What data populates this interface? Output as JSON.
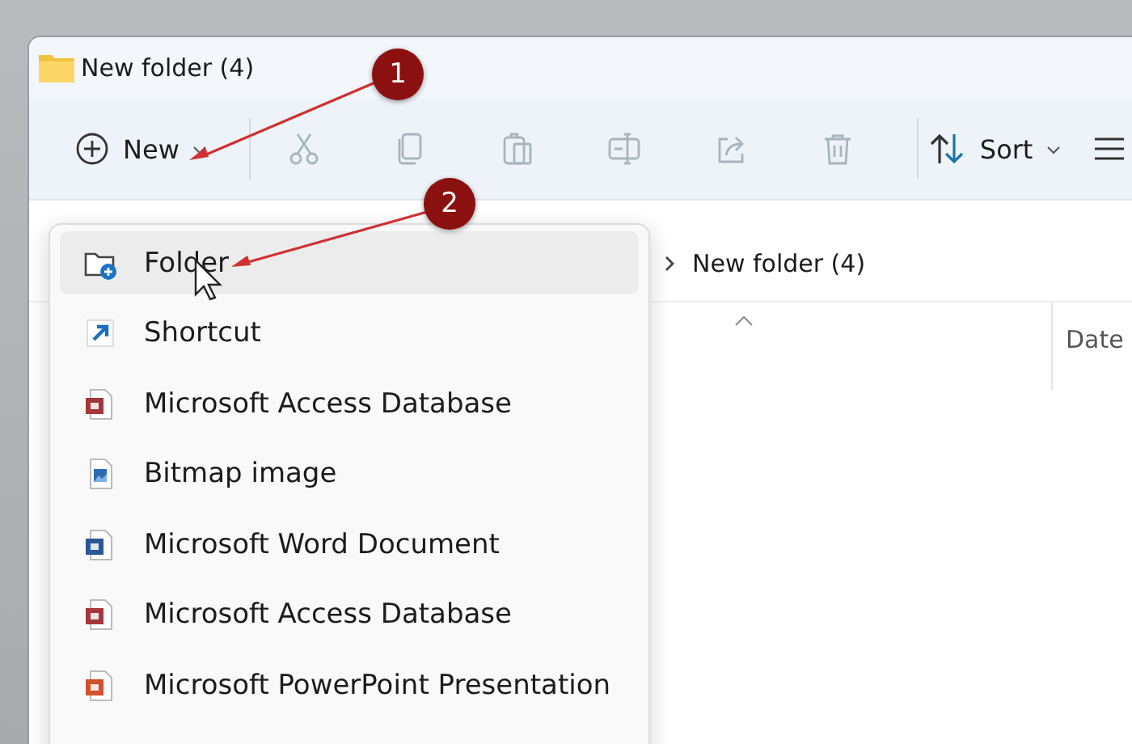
{
  "window": {
    "title": "New folder (4)"
  },
  "toolbar": {
    "items": [
      {
        "kind": "new",
        "label": "New",
        "disabled": false
      },
      {
        "kind": "cut",
        "disabled": true
      },
      {
        "kind": "copy",
        "disabled": true
      },
      {
        "kind": "paste",
        "disabled": true
      },
      {
        "kind": "rename",
        "disabled": true
      },
      {
        "kind": "share",
        "disabled": true
      },
      {
        "kind": "delete",
        "disabled": true
      },
      {
        "kind": "sort",
        "label": "Sort",
        "disabled": false
      },
      {
        "kind": "view"
      }
    ]
  },
  "address_bar": {
    "path": "New folder (4)"
  },
  "file_list": {
    "columns": [
      {
        "label": "Date"
      }
    ]
  },
  "new_menu": {
    "items": [
      {
        "kind": "folder",
        "label": "Folder",
        "selected": true
      },
      {
        "kind": "shortcut",
        "label": "Shortcut",
        "selected": false
      },
      {
        "kind": "access",
        "label": "Microsoft Access Database",
        "selected": false
      },
      {
        "kind": "bitmap",
        "label": "Bitmap image",
        "selected": false
      },
      {
        "kind": "word",
        "label": "Microsoft Word Document",
        "selected": false
      },
      {
        "kind": "access",
        "label": "Microsoft Access Database",
        "selected": false
      },
      {
        "kind": "powerpoint",
        "label": "Microsoft PowerPoint Presentation",
        "selected": false
      }
    ]
  },
  "annotations": [
    {
      "label": "1"
    },
    {
      "label": "2"
    }
  ]
}
